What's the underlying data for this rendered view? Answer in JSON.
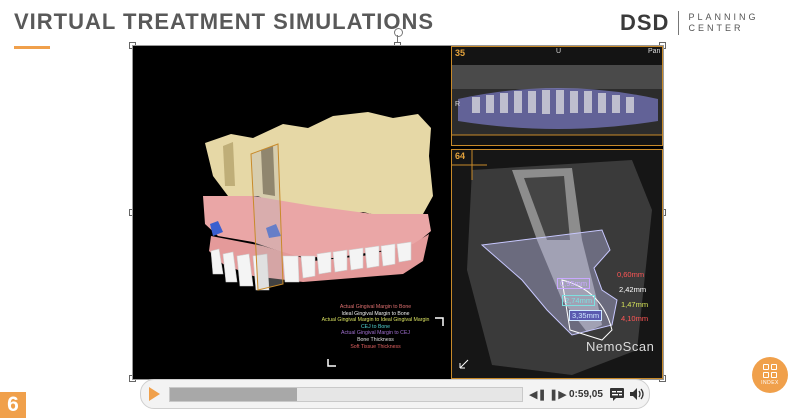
{
  "header": {
    "title": "VIRTUAL TREATMENT SIMULATIONS",
    "logo_main": "DSD",
    "logo_sub_line1": "PLANNING",
    "logo_sub_line2": "CENTER"
  },
  "viewer": {
    "panorama_number": "35",
    "panorama_tag_u": "U",
    "panorama_tag_par": "Pan",
    "panorama_tag_r": "R",
    "section_number": "64",
    "legend": [
      {
        "text": "Actual Gingival Margin to Bone",
        "color": "#e07070"
      },
      {
        "text": "Ideal Gingival Margin to Bone",
        "color": "#f0f0f0"
      },
      {
        "text": "Actual Gingival Margin to Ideal Gingival Margin",
        "color": "#d8e060"
      },
      {
        "text": "CEJ to Bone",
        "color": "#50d0d0"
      },
      {
        "text": "Actual Gingival Margin to CEJ",
        "color": "#a070d0"
      },
      {
        "text": "Bone Thickness",
        "color": "#e0e0e0"
      },
      {
        "text": "Soft Tissue Thickness",
        "color": "#e06060"
      }
    ],
    "measurements_left": [
      {
        "text": "0,95mm",
        "color": "#c9a8ff"
      },
      {
        "text": "2,74mm",
        "color": "#7ee0e0"
      },
      {
        "text": "3,35mm",
        "color": "#cfe8ff"
      }
    ],
    "measurements_right": [
      {
        "text": "0,60mm",
        "color": "#ff5555"
      },
      {
        "text": "2,42mm",
        "color": "#ffffff"
      },
      {
        "text": "1,47mm",
        "color": "#d8e65a"
      },
      {
        "text": "4,10mm",
        "color": "#ff5555"
      }
    ],
    "watermark": "NemoScan"
  },
  "player": {
    "progress_percent": 36,
    "time": "0:59,05",
    "icons": [
      "play-icon",
      "rewind-icon",
      "forward-icon",
      "captions-icon",
      "volume-icon"
    ]
  },
  "page_number": "6",
  "index_button_label": "INDEX",
  "colors": {
    "accent": "#f0a04b",
    "view_border": "#c88a2a"
  }
}
